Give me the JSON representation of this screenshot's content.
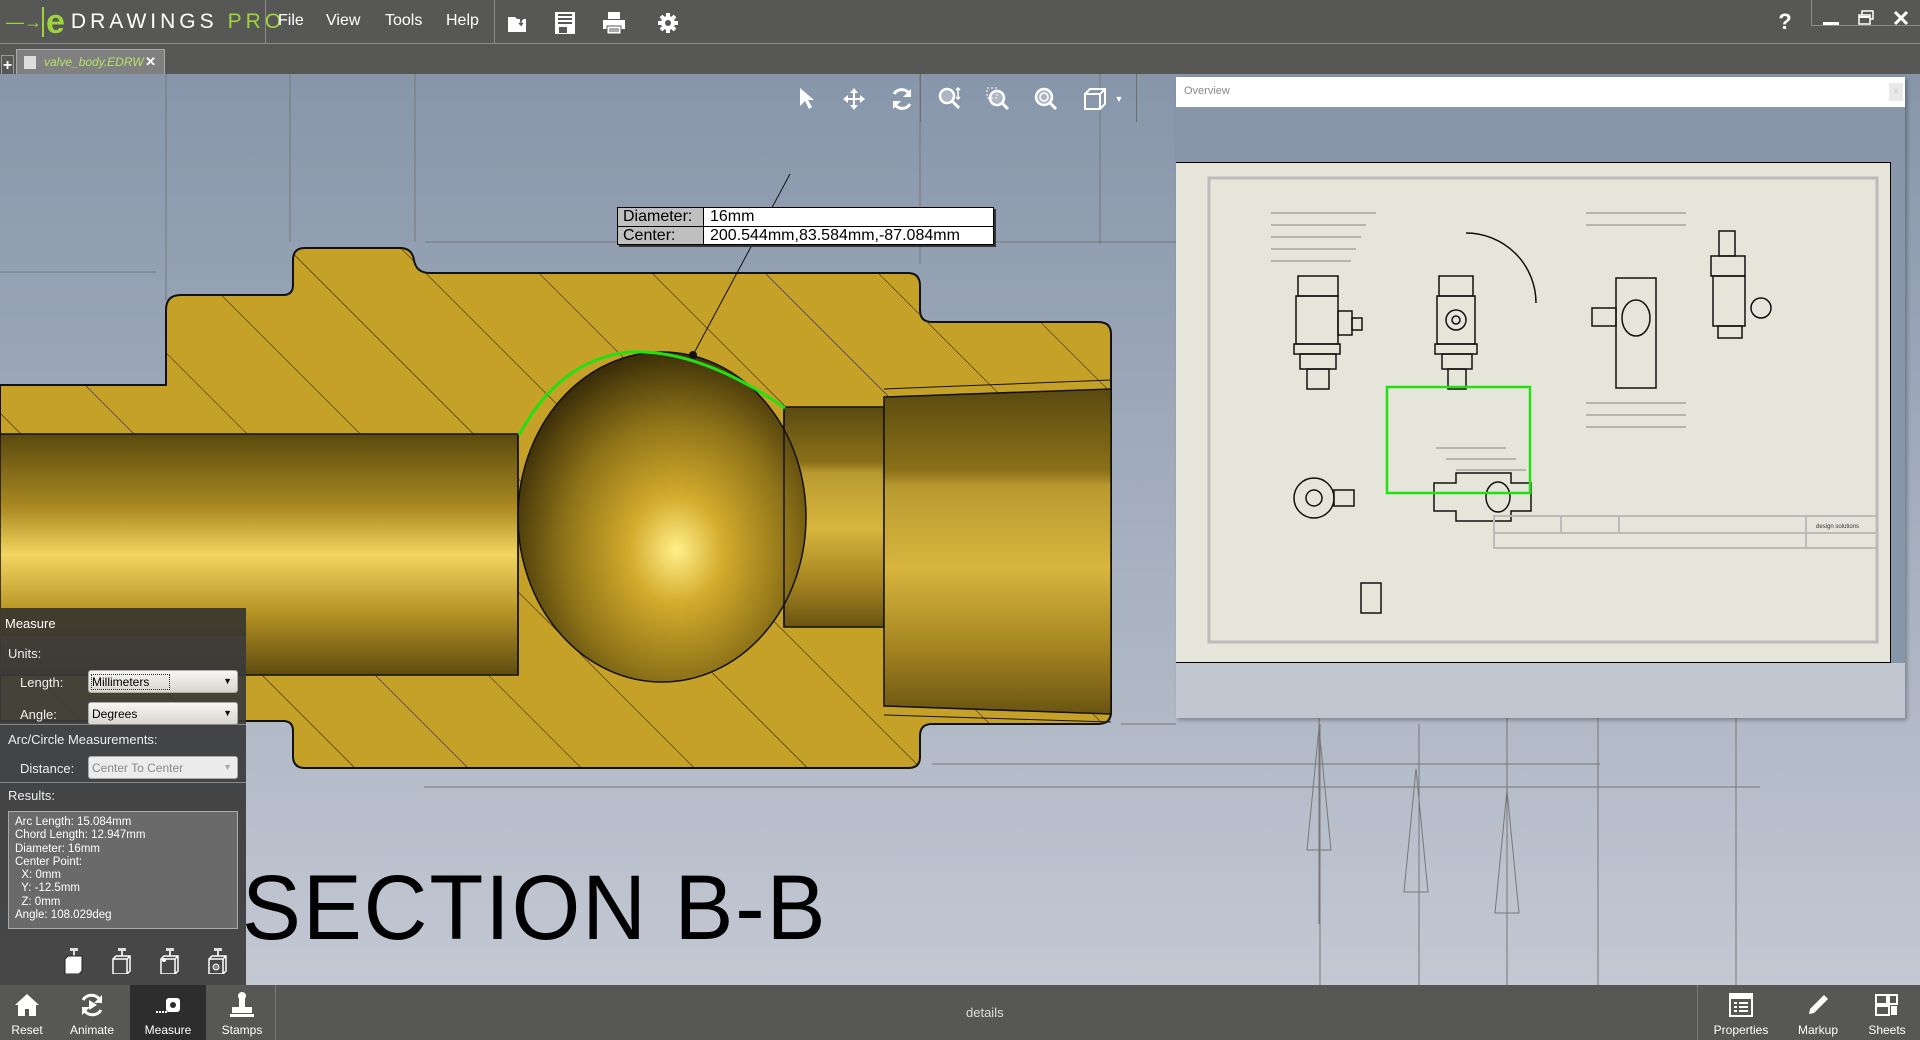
{
  "app": {
    "brand_main": "DRAWINGS",
    "brand_suffix": "PRO",
    "brand_letter": "e"
  },
  "menu": [
    {
      "label": "File"
    },
    {
      "label": "View"
    },
    {
      "label": "Tools"
    },
    {
      "label": "Help"
    }
  ],
  "toolbar_icons": [
    "open-icon",
    "save-icon",
    "print-icon",
    "settings-icon"
  ],
  "window_controls": {
    "help": "?",
    "minimize": "minimize-icon",
    "restore": "restore-icon",
    "close": "close-icon"
  },
  "tabs": [
    {
      "label": "valve_body.EDRW",
      "active": true
    }
  ],
  "tab_add_label": "+",
  "view_tools": [
    "select-icon",
    "pan-icon",
    "rotate-icon",
    "zoom-icon",
    "zoom-to-area-icon",
    "zoom-to-fit-icon",
    "view-orientation-icon"
  ],
  "callout": {
    "rows": [
      {
        "key": "Diameter:",
        "value": "16mm"
      },
      {
        "key": "Center:",
        "value": "200.544mm,83.584mm,-87.084mm"
      }
    ]
  },
  "section_label": "SECTION B-B",
  "overview": {
    "title": "Overview",
    "close_label": "x"
  },
  "measure": {
    "title": "Measure",
    "units_label": "Units:",
    "length_label": "Length:",
    "length_value": "Millimeters",
    "angle_label": "Angle:",
    "angle_value": "Degrees",
    "arc_label": "Arc/Circle Measurements:",
    "distance_label": "Distance:",
    "distance_value": "Center To Center",
    "results_label": "Results:",
    "results": [
      "Arc Length: 15.084mm",
      "Chord Length: 12.947mm",
      "Diameter: 16mm",
      "Center Point:",
      "  X: 0mm",
      "  Y: -12.5mm",
      "  Z: 0mm",
      "Angle: 108.029deg"
    ],
    "tool_icons": [
      "measure-face-icon",
      "measure-edge-icon",
      "measure-vertex-icon",
      "measure-center-icon"
    ]
  },
  "bottombar": {
    "left": [
      {
        "label": "Reset",
        "icon": "home-icon"
      },
      {
        "label": "Animate",
        "icon": "animate-icon"
      },
      {
        "label": "Measure",
        "icon": "measure-tape-icon",
        "active": true
      },
      {
        "label": "Stamps",
        "icon": "stamp-icon"
      }
    ],
    "status": "details",
    "right": [
      {
        "label": "Properties",
        "icon": "properties-icon"
      },
      {
        "label": "Markup",
        "icon": "pencil-icon"
      },
      {
        "label": "Sheets",
        "icon": "sheets-icon"
      }
    ]
  },
  "colors": {
    "brand_green": "#9ed33c",
    "measure_highlight": "#22e011",
    "brass": "#c6a128",
    "canvas_top": "#8796aa",
    "chrome": "#575856"
  }
}
